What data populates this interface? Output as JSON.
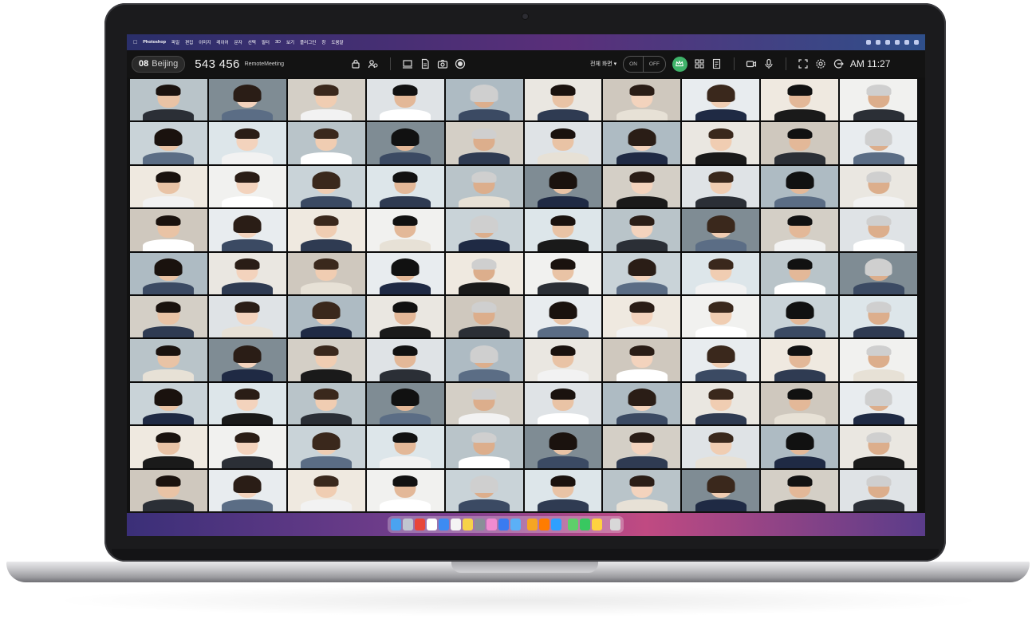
{
  "menubar": {
    "apple": "",
    "app_name": "Photoshop",
    "items": [
      "파일",
      "편집",
      "이미지",
      "레이어",
      "문자",
      "선택",
      "필터",
      "3D",
      "보기",
      "플러그인",
      "창",
      "도움말"
    ]
  },
  "toolbar": {
    "room_number": "08",
    "room_city": "Beijing",
    "meeting_id": "543 456",
    "meeting_name": "RemoteMeeting",
    "view_select": "전체 화면 ▾",
    "on_label": "ON",
    "off_label": "OFF",
    "clock": "AM 11:27"
  },
  "grid": {
    "rows": 10,
    "columns": 10
  },
  "colors": {
    "toolbar_bg": "#131313",
    "crown_green": "#3fb36a",
    "menubar_start": "#2a2f6a"
  },
  "dock_icons": [
    "finder-icon",
    "launchpad-icon",
    "chrome-icon",
    "safari-icon",
    "mail-icon",
    "calendar-icon",
    "notes-icon",
    "settings-icon",
    "photos-icon",
    "appstore-icon",
    "folder-icon",
    "sketch-icon",
    "illustrator-icon",
    "photoshop-icon",
    "maps-icon",
    "messages-icon",
    "app-icon",
    "trash-icon"
  ]
}
